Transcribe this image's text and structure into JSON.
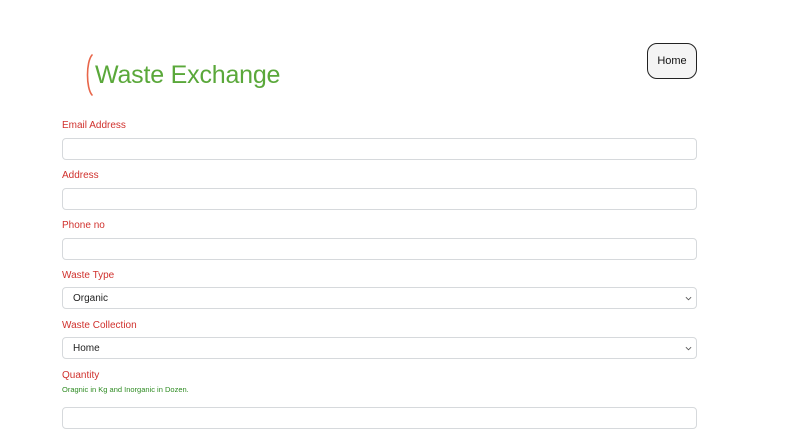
{
  "header": {
    "logo_text": "Waste Exchange",
    "home_label": "Home"
  },
  "form": {
    "email": {
      "label": "Email Address",
      "value": ""
    },
    "address": {
      "label": "Address",
      "value": ""
    },
    "phone": {
      "label": "Phone no",
      "value": ""
    },
    "waste_type": {
      "label": "Waste Type",
      "selected": "Organic"
    },
    "waste_collection": {
      "label": "Waste Collection",
      "selected": "Home"
    },
    "quantity": {
      "label": "Quantity",
      "hint": "Oragnic in Kg and Inorganic in Dozen.",
      "value": ""
    }
  },
  "colors": {
    "logo": "#5aa83a",
    "label": "#d0312d",
    "hint": "#2e8b22",
    "input_border": "#d6d9dc"
  },
  "icons": {
    "logo_mark": "bracket-logo-icon",
    "select_chevron": "chevron-down-icon"
  }
}
